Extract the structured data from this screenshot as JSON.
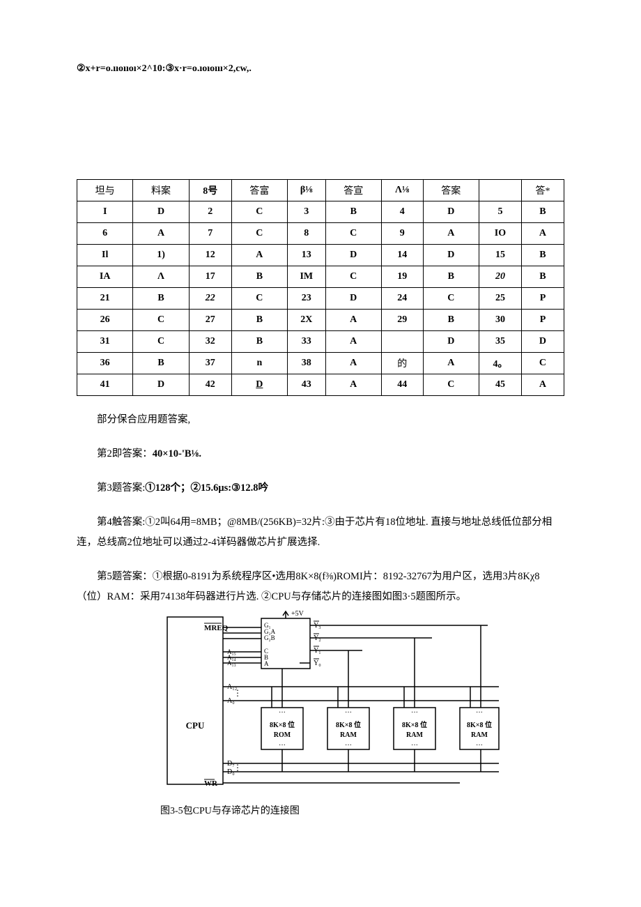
{
  "top_formula": "②x+r=o.ııoııoı×2^10:③x·r=o.ıoıoııı×2,cw,.",
  "table": {
    "headers": [
      "坦与",
      "料案",
      "8号",
      "答富",
      "β⅛",
      "答宣",
      "Λ⅛",
      "答案",
      "",
      "答*"
    ],
    "rows": [
      [
        "I",
        "D",
        "2",
        "C",
        "3",
        "B",
        "4",
        "D",
        "5",
        "B"
      ],
      [
        "6",
        "A",
        "7",
        "C",
        "8",
        "C",
        "9",
        "A",
        "IO",
        "A"
      ],
      [
        "Il",
        "1)",
        "12",
        "A",
        "13",
        "D",
        "14",
        "D",
        "15",
        "B"
      ],
      [
        "IA",
        "Λ",
        "17",
        "B",
        "IM",
        "C",
        "19",
        "B",
        "20",
        "B"
      ],
      [
        "21",
        "B",
        "22",
        "C",
        "23",
        "D",
        "24",
        "C",
        "25",
        "P"
      ],
      [
        "26",
        "C",
        "27",
        "B",
        "2X",
        "A",
        "29",
        "B",
        "30",
        "P"
      ],
      [
        "31",
        "C",
        "32",
        "B",
        "33",
        "A",
        "",
        "D",
        "35",
        "D"
      ],
      [
        "36",
        "B",
        "37",
        "n",
        "38",
        "A",
        "的",
        "A",
        "4。",
        "C"
      ],
      [
        "41",
        "D",
        "42",
        "D",
        "43",
        "A",
        "44",
        "C",
        "45",
        "A"
      ]
    ]
  },
  "p_intro": "部分保合应用题答案,",
  "p2": {
    "prefix": "第2即答案：",
    "body": "40×10-'B⅛."
  },
  "p3": {
    "prefix": "第3题答案:",
    "body": "①128个；②15.6μs:③12.8吟"
  },
  "p4": {
    "prefix": "第4触答案:",
    "body": "①2叫64用=8MB；@8MB/(256KB)=32片:③由于芯片有18位地址. 直接与地址总线低位部分相连，总线高2位地址可以通过2-4详码器做芯片扩展选择."
  },
  "p5": {
    "prefix": "第5题答案：",
    "body": "①根据0-8191为系统程序区•选用8K×8(f⅜)ROMI片：8192-32767为用户区，选用3片8Kχ8（位）RAM：采用74138年码器进行片选. ②CPU与存储芯片的连接图如图3·5题图所示。"
  },
  "caption": "图3-5包CPU与存谛芯片的连接图",
  "chip_labels": {
    "rom": "8K×8 位\nROM",
    "ram": "8K×8 位\nRAM",
    "cpu": "CPU",
    "mreq": "MREQ",
    "wr": "WR",
    "a12": "A₁₂",
    "a0": "A₀",
    "d7": "D₇",
    "d0": "D₀",
    "a15": "A₁₅",
    "a14": "A₁₄",
    "a13": "A₁₃",
    "v5": "+5V",
    "ga": "G₁",
    "gia": "G₂A",
    "gib": "G₂B",
    "ca": "C",
    "cb": "B",
    "cc": "A",
    "y0": "Y₀",
    "y1": "Y₁",
    "y2": "Y₂",
    "y3": "Y₃"
  }
}
